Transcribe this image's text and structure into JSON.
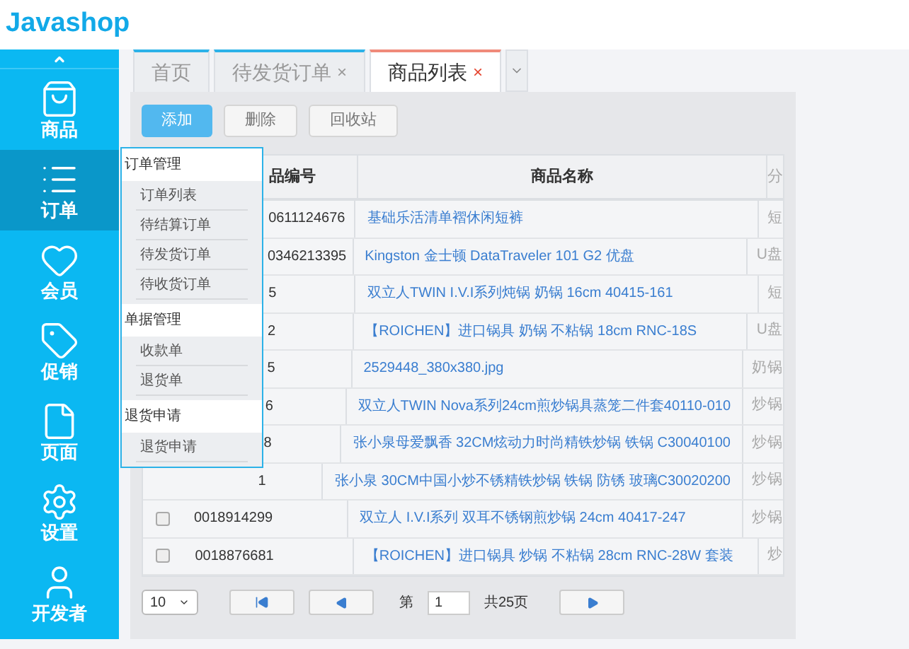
{
  "logo": "Javashop",
  "sidebar": {
    "items": [
      {
        "label": "商品",
        "selected": false
      },
      {
        "label": "订单",
        "selected": true
      },
      {
        "label": "会员",
        "selected": false
      },
      {
        "label": "促销",
        "selected": false
      },
      {
        "label": "页面",
        "selected": false
      },
      {
        "label": "设置",
        "selected": false
      },
      {
        "label": "开发者",
        "selected": false
      }
    ]
  },
  "tabs": [
    {
      "label": "首页",
      "closable": false,
      "selected": false
    },
    {
      "label": "待发货订单",
      "closable": true,
      "selected": false
    },
    {
      "label": "商品列表",
      "closable": true,
      "selected": true
    }
  ],
  "tab_close": "×",
  "toolbar": [
    {
      "label": "添加",
      "primary": true
    },
    {
      "label": "删除",
      "primary": false
    },
    {
      "label": "回收站",
      "primary": false
    }
  ],
  "table": {
    "columns": [
      "品编号",
      "商品名称",
      "分"
    ],
    "rows": [
      {
        "number": "0611124676",
        "partly_hidden": true,
        "name": "基础乐活清单褶休闲短裤",
        "category": "短"
      },
      {
        "number": "0346213395",
        "partly_hidden": true,
        "name": "Kingston 金士顿 DataTraveler 101 G2 优盘",
        "category": "U盘"
      },
      {
        "number": "5",
        "partly_hidden": true,
        "name": "双立人TWIN I.V.I系列炖锅 奶锅 16cm 40415-161",
        "category": "短"
      },
      {
        "number": "2",
        "partly_hidden": true,
        "name": "【ROICHEN】进口锅具 奶锅 不粘锅 18cm RNC-18S",
        "category": "U盘"
      },
      {
        "number": "5",
        "partly_hidden": true,
        "name": "2529448_380x380.jpg",
        "category": "奶锅"
      },
      {
        "number": "6",
        "partly_hidden": true,
        "name": "双立人TWIN Nova系列24cm煎炒锅具蒸笼二件套40110-010",
        "category": "炒锅"
      },
      {
        "number": "8",
        "partly_hidden": true,
        "name": "张小泉母爱飘香 32CM炫动力时尚精铁炒锅 铁锅 C30040100",
        "category": "炒锅"
      },
      {
        "number": "1",
        "partly_hidden": true,
        "name": "张小泉 30CM中国小炒不锈精铁炒锅 铁锅 防锈 玻璃C30020200",
        "category": "炒锅"
      },
      {
        "number": "0018914299",
        "partly_hidden": false,
        "name": "双立人 I.V.I系列 双耳不锈钢煎炒锅 24cm 40417-247",
        "category": "炒锅",
        "checked": false
      },
      {
        "number": "0018876681",
        "partly_hidden": false,
        "name": "【ROICHEN】进口锅具 炒锅 不粘锅 28cm RNC-28W 套装",
        "category": "炒",
        "checked": false
      }
    ]
  },
  "pager": {
    "page_size": "10",
    "page_prefix": "第",
    "page": "1",
    "total": "共25页"
  },
  "popup": {
    "sections": [
      {
        "title": "订单管理",
        "items": [
          "订单列表",
          "待结算订单",
          "待发货订单",
          "待收货订单"
        ]
      },
      {
        "title": "单据管理",
        "items": [
          "收款单",
          "退货单"
        ]
      },
      {
        "title": "退货申请",
        "items": [
          "退货申请"
        ]
      }
    ]
  }
}
